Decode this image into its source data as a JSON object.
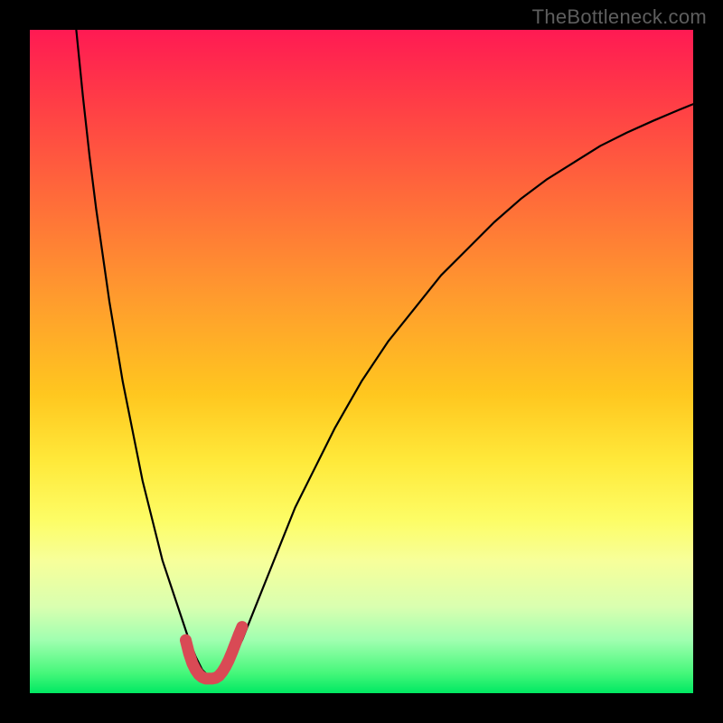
{
  "watermark": "TheBottleneck.com",
  "chart_data": {
    "type": "line",
    "title": "",
    "xlabel": "",
    "ylabel": "",
    "xlim": [
      0,
      100
    ],
    "ylim": [
      0,
      100
    ],
    "grid": false,
    "series": [
      {
        "name": "black-curve",
        "color": "#000000",
        "x": [
          7,
          8,
          9,
          10,
          11,
          12,
          13,
          14,
          15,
          16,
          17,
          18,
          19,
          20,
          21,
          22,
          23,
          24,
          25,
          26,
          27,
          28,
          29,
          30,
          32,
          34,
          36,
          38,
          40,
          43,
          46,
          50,
          54,
          58,
          62,
          66,
          70,
          74,
          78,
          82,
          86,
          90,
          94,
          98,
          100
        ],
        "y": [
          100,
          90,
          81,
          73,
          66,
          59,
          53,
          47,
          42,
          37,
          32,
          28,
          24,
          20,
          17,
          14,
          11,
          8,
          5.5,
          3.5,
          2.5,
          2.2,
          2.7,
          4,
          8,
          13,
          18,
          23,
          28,
          34,
          40,
          47,
          53,
          58,
          63,
          67,
          71,
          74.5,
          77.5,
          80,
          82.5,
          84.5,
          86.3,
          88,
          88.8
        ]
      },
      {
        "name": "red-bottom-overlay",
        "color": "#d94a55",
        "x": [
          23.5,
          24,
          24.5,
          25,
          25.5,
          26,
          26.5,
          27,
          27.5,
          28,
          28.5,
          29,
          29.5,
          30,
          30.5,
          31,
          31.5,
          32
        ],
        "y": [
          8,
          6,
          4.5,
          3.5,
          2.8,
          2.4,
          2.2,
          2.2,
          2.2,
          2.3,
          2.6,
          3.2,
          4,
          5,
          6.2,
          7.5,
          8.8,
          10
        ]
      }
    ],
    "annotations": []
  }
}
